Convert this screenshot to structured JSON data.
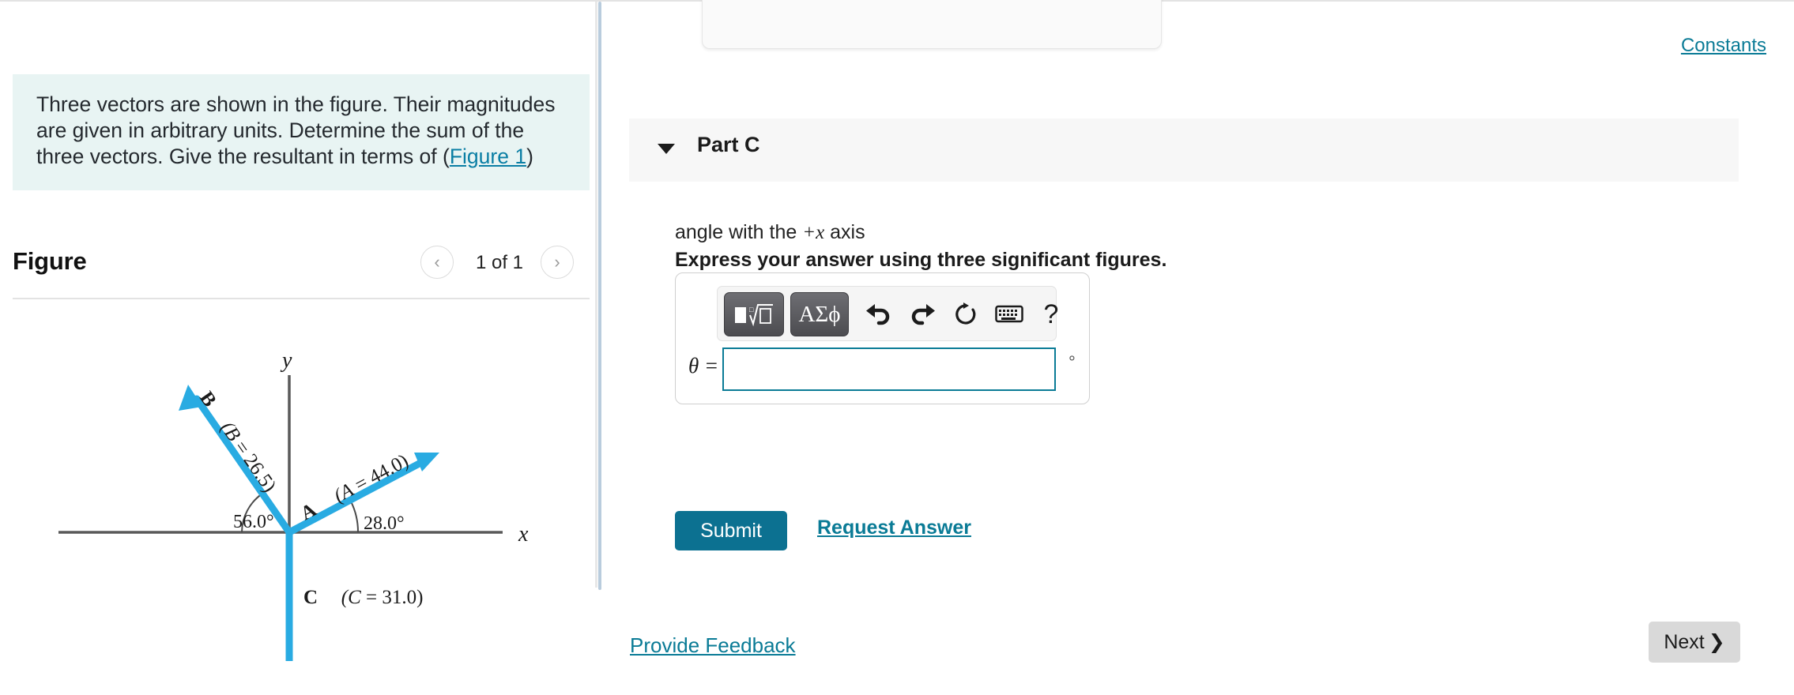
{
  "problem": {
    "text_before_link": "Three vectors are shown in the figure. Their magnitudes are given in arbitrary units. Determine the sum of the three vectors. Give the resultant in terms of (",
    "link_label": "Figure 1",
    "text_after_link": ")"
  },
  "figure": {
    "title": "Figure",
    "counter": "1 of 1",
    "prev_icon": "chevron-left-icon",
    "next_icon": "chevron-right-icon",
    "x_axis_label": "x",
    "y_axis_label": "y",
    "vectors": [
      {
        "name": "A",
        "label": "(A = 44.0)",
        "magnitude": 44.0,
        "angle_deg": 28.0,
        "angle_label": "28.0°",
        "direction": "above +x axis"
      },
      {
        "name": "B",
        "label": "(B = 26.5)",
        "magnitude": 26.5,
        "angle_deg": 124.0,
        "angle_label": "56.0°",
        "direction": "56.0 degrees from -x axis"
      },
      {
        "name": "C",
        "label": "(C = 31.0)",
        "magnitude": 31.0,
        "angle_deg": 270.0,
        "angle_label": "",
        "direction": "straight down along -y axis"
      }
    ],
    "vector_color": "#29abe2",
    "axis_color": "#5a5a5a"
  },
  "right": {
    "constants_label": "Constants",
    "part_title": "Part C",
    "caret_icon": "caret-down-icon",
    "question_prefix": "angle with the ",
    "question_var": "+x",
    "question_suffix": " axis",
    "sigfig_instruction": "Express your answer using three significant figures.",
    "toolbar": {
      "template_label": "■√□",
      "greek_label": "ΑΣϕ",
      "undo_icon": "undo-arrow-icon",
      "redo_icon": "redo-arrow-icon",
      "reset_icon": "reset-circular-arrow-icon",
      "keyboard_icon": "keyboard-icon",
      "help_label": "?"
    },
    "answer": {
      "label": "θ =",
      "value": "",
      "placeholder": "",
      "unit": "°"
    },
    "submit_label": "Submit",
    "request_answer_label": "Request Answer",
    "provide_feedback_label": "Provide Feedback",
    "next_label": "Next",
    "next_icon": "chevron-right-icon"
  },
  "colors": {
    "accent_teal": "#0a7b96",
    "submit_teal": "#0c7191",
    "problem_box_bg": "#e8f4f3",
    "part_header_bg": "#f7f7f7",
    "vector_blue": "#29abe2"
  }
}
